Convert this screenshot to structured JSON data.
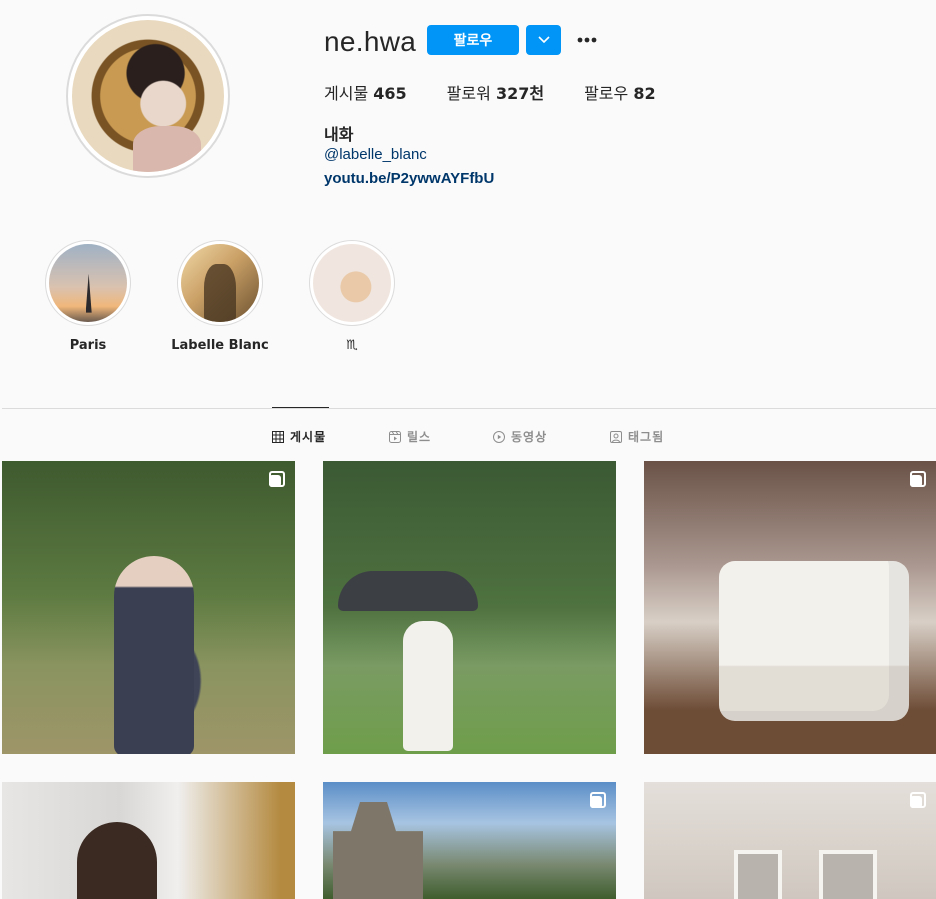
{
  "profile": {
    "username": "ne.hwa",
    "follow_label": "팔로우",
    "more_label": "•••",
    "stats": {
      "posts_label": "게시물",
      "posts_value": "465",
      "followers_label": "팔로워",
      "followers_value": "327천",
      "following_label": "팔로우",
      "following_value": "82"
    },
    "full_name": "내화",
    "handle": "@labelle_blanc",
    "link": "youtu.be/P2ywwAYFfbU"
  },
  "highlights": [
    {
      "label": "Paris"
    },
    {
      "label": "Labelle Blanc"
    },
    {
      "label": "♏"
    }
  ],
  "tabs": [
    {
      "label": "게시물",
      "icon": "grid-icon",
      "active": true
    },
    {
      "label": "릴스",
      "icon": "reels-icon",
      "active": false
    },
    {
      "label": "동영상",
      "icon": "video-icon",
      "active": false
    },
    {
      "label": "태그됨",
      "icon": "tagged-icon",
      "active": false
    }
  ],
  "colors": {
    "accent": "#0095f6",
    "link": "#00376b",
    "background": "#fafafa"
  },
  "posts": [
    {
      "multi": true
    },
    {
      "multi": false
    },
    {
      "multi": true
    },
    {
      "multi": false
    },
    {
      "multi": true
    },
    {
      "multi": true
    }
  ]
}
